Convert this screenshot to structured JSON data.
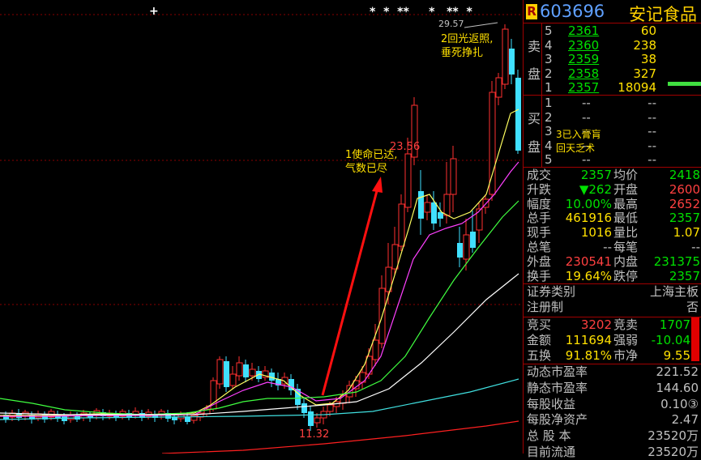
{
  "header": {
    "badge": "R",
    "code": "603696",
    "name": "安记食品"
  },
  "chart": {
    "annotations": {
      "price_top": "29.57",
      "price_mid": "23.56",
      "price_low": "11.32",
      "note1_line1": "1使命已达,",
      "note1_line2": "气数已尽",
      "note2_line1": "2回光返照,",
      "note2_line2": "垂死挣扎"
    },
    "top_marker": "+",
    "star_markers": "*  *  **     *   **  *"
  },
  "orderbook": {
    "sell_label": [
      "卖",
      "盘"
    ],
    "buy_label": [
      "买",
      "盘"
    ],
    "sell": [
      {
        "level": "5",
        "price": "2361",
        "vol": "60"
      },
      {
        "level": "4",
        "price": "2360",
        "vol": "238"
      },
      {
        "level": "3",
        "price": "2359",
        "vol": "38"
      },
      {
        "level": "2",
        "price": "2358",
        "vol": "327"
      },
      {
        "level": "1",
        "price": "2357",
        "vol": "18094"
      }
    ],
    "buy": [
      {
        "level": "1",
        "price": "--",
        "vol": "--"
      },
      {
        "level": "2",
        "price": "--",
        "vol": "--"
      },
      {
        "level": "3",
        "price": "--",
        "vol": "--"
      },
      {
        "level": "4",
        "price": "--",
        "vol": "--"
      },
      {
        "level": "5",
        "price": "--",
        "vol": "--"
      }
    ],
    "buy_note_line1": "3已入膏肓",
    "buy_note_line2": "回天乏术"
  },
  "quote": {
    "rows": [
      {
        "l1": "成交",
        "v1": "2357",
        "l2": "均价",
        "v2": "2418"
      },
      {
        "l1": "升跌",
        "v1": "▼262",
        "l2": "开盘",
        "v2": "2600"
      },
      {
        "l1": "幅度",
        "v1": "10.00%",
        "l2": "最高",
        "v2": "2652"
      },
      {
        "l1": "总手",
        "v1": "461916",
        "l2": "最低",
        "v2": "2357"
      },
      {
        "l1": "现手",
        "v1": "1016",
        "l2": "量比",
        "v2": "1.07"
      },
      {
        "l1": "总笔",
        "v1": "--",
        "l2": "每笔",
        "v2": "--"
      },
      {
        "l1": "外盘",
        "v1": "230541",
        "l2": "内盘",
        "v2": "231375"
      },
      {
        "l1": "换手",
        "v1": "19.64%",
        "l2": "跌停",
        "v2": "2357"
      }
    ]
  },
  "info": {
    "category_label": "证券类别",
    "category_value": "上海主板",
    "register_label": "注册制",
    "register_value": "否"
  },
  "auction": {
    "rows": [
      {
        "l1": "竞买",
        "v1": "3202",
        "l2": "竞卖",
        "v2": "1707"
      },
      {
        "l1": "金额",
        "v1": "111694",
        "l2": "强弱",
        "v2": "-10.04"
      },
      {
        "l1": "五换",
        "v1": "91.81%",
        "l2": "市净",
        "v2": "9.55"
      }
    ]
  },
  "fundamentals": [
    {
      "label": "动态市盈率",
      "value": "221.52"
    },
    {
      "label": "静态市盈率",
      "value": "144.60"
    },
    {
      "label": "每股收益",
      "value": "0.10③"
    },
    {
      "label": "每股净资产",
      "value": "2.47"
    },
    {
      "label": "总 股 本",
      "value": "23520万"
    },
    {
      "label": "目前流通",
      "value": "23520万"
    }
  ],
  "colors": {
    "up": "#ff3030",
    "down": "#40e0ff",
    "panel_border": "#a00000",
    "ma5": "#ffff60",
    "ma10": "#ff40ff",
    "ma20": "#40ff40",
    "ma60": "#ffffff"
  }
}
